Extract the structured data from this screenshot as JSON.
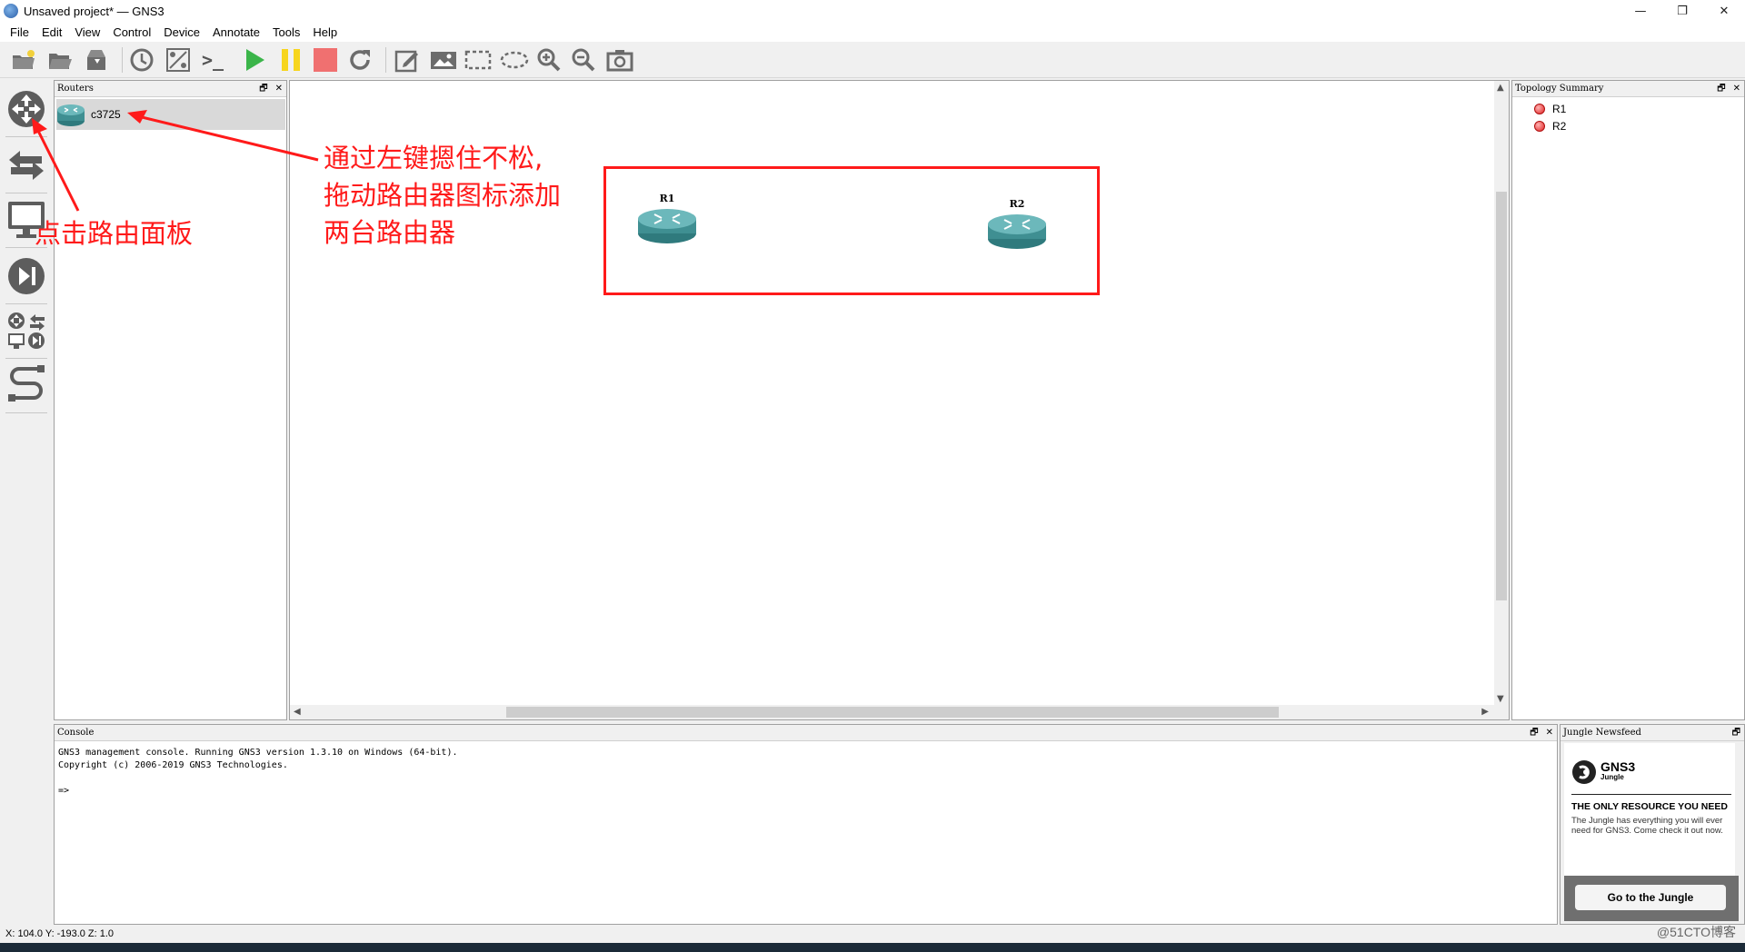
{
  "window": {
    "title": "Unsaved project* — GNS3",
    "minimize": "—",
    "restore": "❐",
    "close": "✕"
  },
  "menu": [
    "File",
    "Edit",
    "View",
    "Control",
    "Device",
    "Annotate",
    "Tools",
    "Help"
  ],
  "toolbar": {
    "icons": [
      "new-project-icon",
      "open-project-icon",
      "save-project-icon",
      "snapshot-icon",
      "show-interface-labels-icon",
      "console-all-icon",
      "start-all-icon",
      "suspend-all-icon",
      "stop-all-icon",
      "reload-all-icon",
      "add-note-icon",
      "insert-picture-icon",
      "draw-rectangle-icon",
      "draw-ellipse-icon",
      "zoom-in-icon",
      "zoom-out-icon",
      "screenshot-icon"
    ],
    "console_glyph": ">_"
  },
  "dock": {
    "icons": [
      "routers-icon",
      "switches-icon",
      "end-devices-icon",
      "security-devices-icon",
      "all-devices-icon",
      "add-link-icon"
    ]
  },
  "routers_panel": {
    "title": "Routers",
    "item": "c3725"
  },
  "topology_panel": {
    "title": "Topology Summary",
    "items": [
      "R1",
      "R2"
    ]
  },
  "canvas": {
    "nodes": [
      "R1",
      "R2"
    ]
  },
  "annotations": {
    "right_lines": [
      "通过左键摁住不松,",
      "拖动路由器图标添加",
      "两台路由器"
    ],
    "left": "点击路由面板"
  },
  "console_panel": {
    "title": "Console",
    "text": "GNS3 management console. Running GNS3 version 1.3.10 on Windows (64-bit).\nCopyright (c) 2006-2019 GNS3 Technologies.\n\n=>"
  },
  "jungle_panel": {
    "title": "Jungle Newsfeed",
    "logo_main": "GNS3",
    "logo_sub": "Jungle",
    "headline": "THE ONLY RESOURCE YOU NEED",
    "body": "The Jungle has everything you will ever need for GNS3. Come check it out now.",
    "button": "Go to the Jungle"
  },
  "status": {
    "coords": "X: 104.0 Y: -193.0 Z: 1.0"
  },
  "watermark": "@51CTO博客",
  "colors": {
    "annotation": "#ff1a1a",
    "router": "#3f8f92",
    "start": "#3bb54a",
    "suspend": "#f7d51d",
    "stop": "#f07070"
  }
}
